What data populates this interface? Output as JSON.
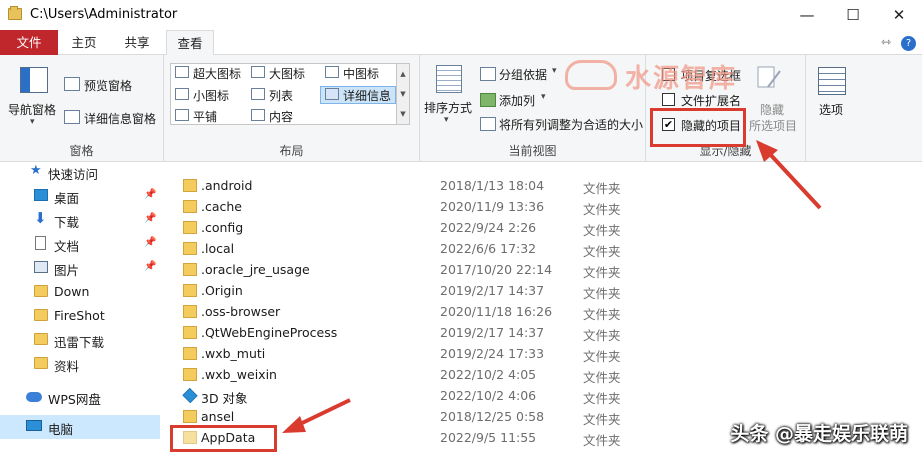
{
  "window": {
    "title": "C:\\Users\\Administrator",
    "minimize": "—",
    "maximize": "☐",
    "close": "✕"
  },
  "tabs": [
    {
      "label": "文件"
    },
    {
      "label": "主页"
    },
    {
      "label": "共享"
    },
    {
      "label": "查看"
    }
  ],
  "tabbar_right": {
    "pin": "⇿",
    "help": "?"
  },
  "ribbon": {
    "pane_group": {
      "navigation_pane": "导航窗格",
      "preview_pane": "预览窗格",
      "details_pane": "详细信息窗格",
      "label": "窗格"
    },
    "layout_group": {
      "options": [
        "超大图标",
        "大图标",
        "中图标",
        "小图标",
        "列表",
        "详细信息",
        "平铺",
        "内容"
      ],
      "selected": "详细信息",
      "label": "布局"
    },
    "current_view_group": {
      "sort_by": "排序方式",
      "group_by": "分组依据",
      "add_columns": "添加列",
      "size_all_columns": "将所有列调整为合适的大小",
      "label": "当前视图"
    },
    "show_hide_group": {
      "item_check_boxes": "项目复选框",
      "file_name_extensions": "文件扩展名",
      "hidden_items": "隐藏的项目",
      "hidden_items_checked": "✔",
      "hide_line1": "隐藏",
      "hide_line2": "所选项目",
      "label": "显示/隐藏"
    },
    "options": "选项"
  },
  "watermark": "水源智库",
  "nav": {
    "items": [
      {
        "label": "快速访问"
      },
      {
        "label": "桌面"
      },
      {
        "label": "下载"
      },
      {
        "label": "文档"
      },
      {
        "label": "图片"
      },
      {
        "label": "Down"
      },
      {
        "label": "FireShot"
      },
      {
        "label": "迅雷下载"
      },
      {
        "label": "资料"
      },
      {
        "label": "WPS网盘"
      },
      {
        "label": "电脑"
      }
    ],
    "pin": "📌"
  },
  "files": [
    {
      "name": ".android",
      "date": "2018/1/13 18:04",
      "type": "文件夹"
    },
    {
      "name": ".cache",
      "date": "2020/11/9 13:36",
      "type": "文件夹"
    },
    {
      "name": ".config",
      "date": "2022/9/24 2:26",
      "type": "文件夹"
    },
    {
      "name": ".local",
      "date": "2022/6/6 17:32",
      "type": "文件夹"
    },
    {
      "name": ".oracle_jre_usage",
      "date": "2017/10/20 22:14",
      "type": "文件夹"
    },
    {
      "name": ".Origin",
      "date": "2019/2/17 14:37",
      "type": "文件夹"
    },
    {
      "name": ".oss-browser",
      "date": "2020/11/18 16:26",
      "type": "文件夹"
    },
    {
      "name": ".QtWebEngineProcess",
      "date": "2019/2/17 14:37",
      "type": "文件夹"
    },
    {
      "name": ".wxb_muti",
      "date": "2019/2/24 17:33",
      "type": "文件夹"
    },
    {
      "name": ".wxb_weixin",
      "date": "2022/10/2 4:05",
      "type": "文件夹"
    },
    {
      "name": "3D 对象",
      "date": "2022/10/2 4:06",
      "type": "文件夹"
    },
    {
      "name": "ansel",
      "date": "2018/12/25 0:58",
      "type": "文件夹"
    },
    {
      "name": "AppData",
      "date": "2022/9/5 11:55",
      "type": "文件夹"
    }
  ],
  "credit": "头条 @暴走娱乐联萌",
  "colors": {
    "accent_red": "#d93b2f",
    "file_tab": "#c0272d",
    "selection": "#cce8ff"
  }
}
